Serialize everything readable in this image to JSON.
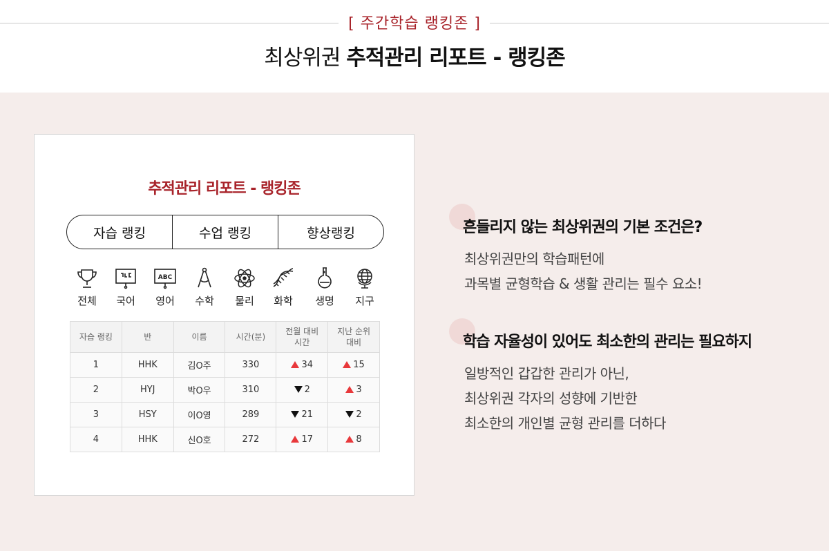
{
  "header": {
    "eyebrow": "[ 주간학습 랭킹존 ]",
    "title_light": "최상위권",
    "title_bold": "추적관리 리포트 - 랭킹존"
  },
  "card": {
    "title": "추적관리 리포트 - 랭킹존",
    "tabs": [
      "자습 랭킹",
      "수업 랭킹",
      "향상랭킹"
    ],
    "subjects": [
      {
        "label": "전체",
        "icon": "trophy-icon"
      },
      {
        "label": "국어",
        "icon": "korean-board-icon"
      },
      {
        "label": "영어",
        "icon": "abc-board-icon"
      },
      {
        "label": "수학",
        "icon": "compass-icon"
      },
      {
        "label": "물리",
        "icon": "atom-icon"
      },
      {
        "label": "화학",
        "icon": "dna-icon"
      },
      {
        "label": "생명",
        "icon": "flask-icon"
      },
      {
        "label": "지구",
        "icon": "globe-icon"
      }
    ],
    "table": {
      "headers": [
        "자습 랭킹",
        "반",
        "이름",
        "시간(분)",
        "전월 대비\n시간",
        "지난 순위\n대비"
      ],
      "rows": [
        {
          "rank": "1",
          "class": "HHK",
          "name": "김O주",
          "time": "330",
          "month_dir": "up",
          "month": "34",
          "prev_dir": "up",
          "prev": "15"
        },
        {
          "rank": "2",
          "class": "HYJ",
          "name": "박O우",
          "time": "310",
          "month_dir": "down",
          "month": "2",
          "prev_dir": "up",
          "prev": "3"
        },
        {
          "rank": "3",
          "class": "HSY",
          "name": "이O영",
          "time": "289",
          "month_dir": "down",
          "month": "21",
          "prev_dir": "down",
          "prev": "2"
        },
        {
          "rank": "4",
          "class": "HHK",
          "name": "신O호",
          "time": "272",
          "month_dir": "up",
          "month": "17",
          "prev_dir": "up",
          "prev": "8"
        }
      ]
    }
  },
  "points": [
    {
      "title": "흔들리지 않는 최상위권의 기본 조건은?",
      "lines": [
        "최상위권만의 학습패턴에",
        "과목별 균형학습 & 생활 관리는 필수 요소!"
      ]
    },
    {
      "title": "학습 자율성이 있어도 최소한의 관리는 필요하지",
      "lines": [
        "일방적인 갑갑한 관리가 아닌,",
        "최상위권 각자의 성향에 기반한",
        "최소한의 개인별 균형 관리를 더하다"
      ]
    }
  ],
  "colors": {
    "accent": "#a8232a",
    "band": "#f5edeb",
    "up": "#e8383b",
    "down": "#111111"
  }
}
